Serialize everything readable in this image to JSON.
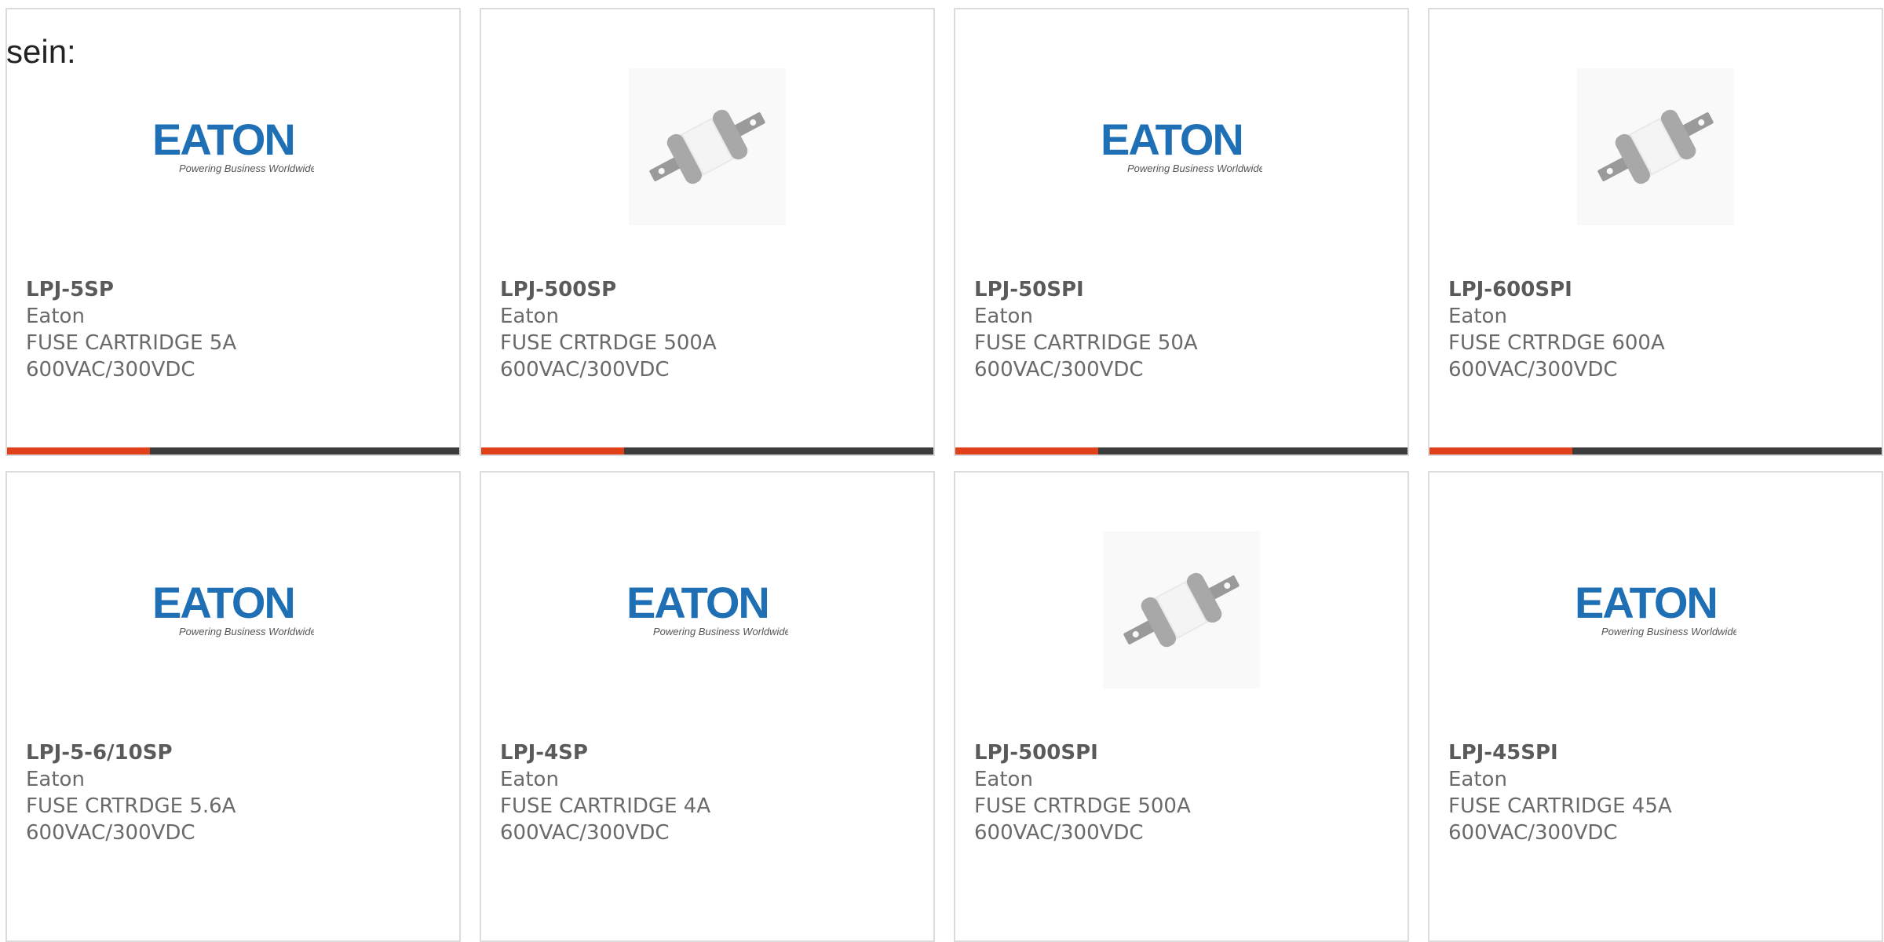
{
  "intro": {
    "text": "sein:"
  },
  "brand": {
    "logo_word": "EATON",
    "logo_tagline": "Powering Business Worldwide",
    "logo_color": "#1f6fb5"
  },
  "colors": {
    "accent": "#e0401a",
    "bar_dark": "#3c3c3c",
    "border": "#dcdcdc",
    "text_muted": "#6a6a6a"
  },
  "products": [
    {
      "part": "LPJ-5SP",
      "manufacturer": "Eaton",
      "desc1": "FUSE CARTRIDGE 5A",
      "desc2": "600VAC/300VDC",
      "image": "eaton-logo"
    },
    {
      "part": "LPJ-500SP",
      "manufacturer": "Eaton",
      "desc1": "FUSE CRTRDGE 500A",
      "desc2": "600VAC/300VDC",
      "image": "fuse-photo"
    },
    {
      "part": "LPJ-50SPI",
      "manufacturer": "Eaton",
      "desc1": "FUSE CARTRIDGE 50A",
      "desc2": "600VAC/300VDC",
      "image": "eaton-logo"
    },
    {
      "part": "LPJ-600SPI",
      "manufacturer": "Eaton",
      "desc1": "FUSE CRTRDGE 600A",
      "desc2": "600VAC/300VDC",
      "image": "fuse-photo"
    },
    {
      "part": "LPJ-5-6/10SP",
      "manufacturer": "Eaton",
      "desc1": "FUSE CRTRDGE 5.6A",
      "desc2": "600VAC/300VDC",
      "image": "eaton-logo"
    },
    {
      "part": "LPJ-4SP",
      "manufacturer": "Eaton",
      "desc1": "FUSE CARTRIDGE 4A",
      "desc2": "600VAC/300VDC",
      "image": "eaton-logo"
    },
    {
      "part": "LPJ-500SPI",
      "manufacturer": "Eaton",
      "desc1": "FUSE CRTRDGE 500A",
      "desc2": "600VAC/300VDC",
      "image": "fuse-photo"
    },
    {
      "part": "LPJ-45SPI",
      "manufacturer": "Eaton",
      "desc1": "FUSE CARTRIDGE 45A",
      "desc2": "600VAC/300VDC",
      "image": "eaton-logo"
    }
  ]
}
